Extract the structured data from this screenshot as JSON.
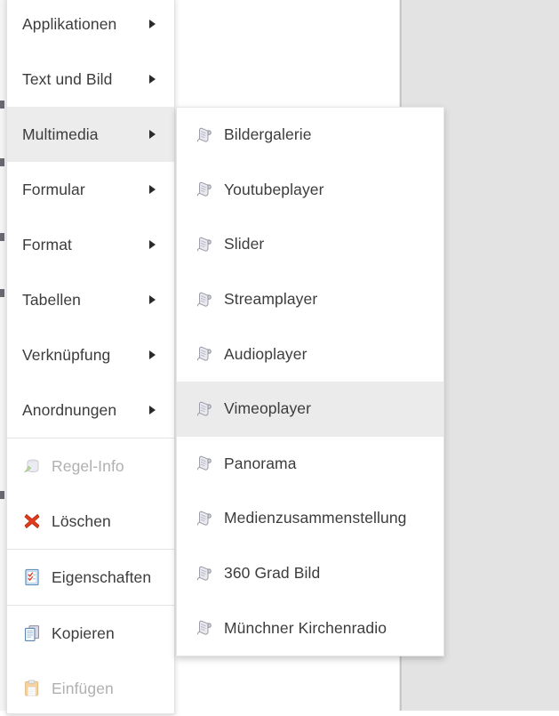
{
  "window": {
    "type": "context-menu",
    "language": "de"
  },
  "colors": {
    "menu_background": "#ffffff",
    "menu_highlight": "#ebebeb",
    "text": "#3c3c3c",
    "text_disabled": "#b0b0b0",
    "separator": "#e4e4e4",
    "canvas_gutter": "#e3e3e3",
    "delete_icon": "#e03a20",
    "paste_icon": "#f0a840",
    "properties_icon": "#6fa8d8"
  },
  "context_menu": {
    "groups": [
      {
        "items": [
          {
            "label": "Applikationen",
            "icon": "submenu-arrow-icon",
            "has_submenu": true,
            "disabled": false,
            "highlighted": false
          },
          {
            "label": "Text und Bild",
            "icon": "submenu-arrow-icon",
            "has_submenu": true,
            "disabled": false,
            "highlighted": false
          },
          {
            "label": "Multimedia",
            "icon": "submenu-arrow-icon",
            "has_submenu": true,
            "disabled": false,
            "highlighted": true
          },
          {
            "label": "Formular",
            "icon": "submenu-arrow-icon",
            "has_submenu": true,
            "disabled": false,
            "highlighted": false
          },
          {
            "label": "Format",
            "icon": "submenu-arrow-icon",
            "has_submenu": true,
            "disabled": false,
            "highlighted": false
          },
          {
            "label": "Tabellen",
            "icon": "submenu-arrow-icon",
            "has_submenu": true,
            "disabled": false,
            "highlighted": false
          },
          {
            "label": "Verknüpfung",
            "icon": "submenu-arrow-icon",
            "has_submenu": true,
            "disabled": false,
            "highlighted": false
          },
          {
            "label": "Anordnungen",
            "icon": "submenu-arrow-icon",
            "has_submenu": true,
            "disabled": false,
            "highlighted": false
          }
        ]
      },
      {
        "items": [
          {
            "label": "Regel-Info",
            "icon": "rule-info-icon",
            "has_submenu": false,
            "disabled": true,
            "highlighted": false
          },
          {
            "label": "Löschen",
            "icon": "delete-x-icon",
            "has_submenu": false,
            "disabled": false,
            "highlighted": false
          }
        ]
      },
      {
        "items": [
          {
            "label": "Eigenschaften",
            "icon": "properties-checklist-icon",
            "has_submenu": false,
            "disabled": false,
            "highlighted": false
          }
        ]
      },
      {
        "items": [
          {
            "label": "Kopieren",
            "icon": "copy-pages-icon",
            "has_submenu": false,
            "disabled": false,
            "highlighted": false
          },
          {
            "label": "Einfügen",
            "icon": "paste-clipboard-icon",
            "has_submenu": false,
            "disabled": true,
            "highlighted": false
          }
        ]
      }
    ]
  },
  "submenu": {
    "parent": "Multimedia",
    "items": [
      {
        "label": "Bildergalerie",
        "icon": "scroll-module-icon",
        "highlighted": false
      },
      {
        "label": "Youtubeplayer",
        "icon": "scroll-module-icon",
        "highlighted": false
      },
      {
        "label": "Slider",
        "icon": "scroll-module-icon",
        "highlighted": false
      },
      {
        "label": "Streamplayer",
        "icon": "scroll-module-icon",
        "highlighted": false
      },
      {
        "label": "Audioplayer",
        "icon": "scroll-module-icon",
        "highlighted": false
      },
      {
        "label": "Vimeoplayer",
        "icon": "scroll-module-icon",
        "highlighted": true
      },
      {
        "label": "Panorama",
        "icon": "scroll-module-icon",
        "highlighted": false
      },
      {
        "label": "Medienzusammenstellung",
        "icon": "scroll-module-icon",
        "highlighted": false
      },
      {
        "label": "360 Grad Bild",
        "icon": "scroll-module-icon",
        "highlighted": false
      },
      {
        "label": "Münchner Kirchenradio",
        "icon": "scroll-module-icon",
        "highlighted": false
      }
    ]
  }
}
